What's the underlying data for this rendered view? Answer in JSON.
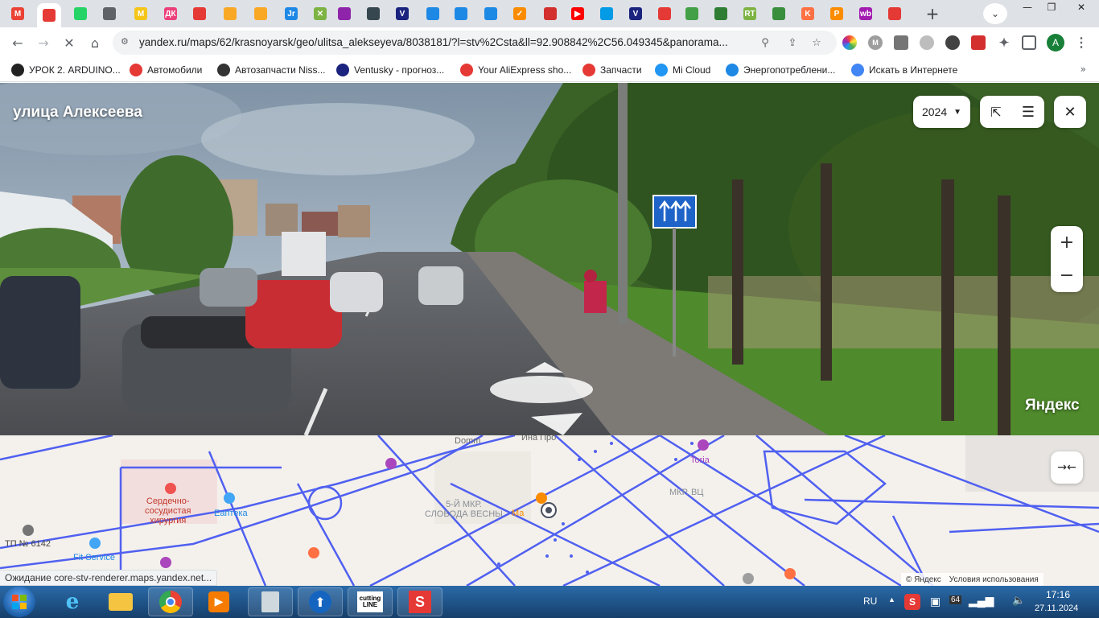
{
  "browser": {
    "tabs": [
      {
        "name": "gmail",
        "label": "M",
        "color": "#ea4335"
      },
      {
        "name": "yandex-maps",
        "label": "",
        "color": "#e53935",
        "active": true
      },
      {
        "name": "whatsapp",
        "label": "",
        "color": "#25d366"
      },
      {
        "name": "chrome-tab",
        "label": "",
        "color": "#5f6368"
      },
      {
        "name": "m-tab",
        "label": "M",
        "color": "#f5c518"
      },
      {
        "name": "dk-tab",
        "label": "ДК",
        "color": "#ec407a"
      },
      {
        "name": "aliexpress-tab",
        "label": "",
        "color": "#e53935"
      },
      {
        "name": "drop-tab-1",
        "label": "",
        "color": "#f9a825"
      },
      {
        "name": "drop-tab-2",
        "label": "",
        "color": "#f9a825"
      },
      {
        "name": "jr-tab",
        "label": "Jr",
        "color": "#1e88e5"
      },
      {
        "name": "x-tab",
        "label": "✕",
        "color": "#7cb342"
      },
      {
        "name": "apps-tab",
        "label": "",
        "color": "#8e24aa"
      },
      {
        "name": "hex-tab",
        "label": "",
        "color": "#37474f"
      },
      {
        "name": "v-tab-1",
        "label": "V",
        "color": "#1a237e"
      },
      {
        "name": "chart-tab-1",
        "label": "",
        "color": "#1e88e5"
      },
      {
        "name": "chart-tab-2",
        "label": "",
        "color": "#1e88e5"
      },
      {
        "name": "chart-tab-3",
        "label": "",
        "color": "#1e88e5"
      },
      {
        "name": "check-tab",
        "label": "✓",
        "color": "#fb8c00"
      },
      {
        "name": "news-tab",
        "label": "",
        "color": "#d32f2f"
      },
      {
        "name": "youtube-tab",
        "label": "▶",
        "color": "#ff0000"
      },
      {
        "name": "cloud-tab",
        "label": "",
        "color": "#039be5"
      },
      {
        "name": "v-tab-2",
        "label": "V",
        "color": "#1a237e"
      },
      {
        "name": "aid-tab",
        "label": "",
        "color": "#e53935"
      },
      {
        "name": "arrow-tab",
        "label": "",
        "color": "#43a047"
      },
      {
        "name": "bank-tab",
        "label": "",
        "color": "#2e7d32"
      },
      {
        "name": "rt-tab",
        "label": "RT",
        "color": "#7cb342"
      },
      {
        "name": "museum-tab",
        "label": "",
        "color": "#388e3c"
      },
      {
        "name": "k-tab",
        "label": "K",
        "color": "#ff7043"
      },
      {
        "name": "p-tab",
        "label": "P",
        "color": "#fb8c00"
      },
      {
        "name": "wb-tab",
        "label": "wb",
        "color": "#a21caf"
      },
      {
        "name": "ozon-tab",
        "label": "",
        "color": "#e53935"
      }
    ],
    "url": "yandex.ru/maps/62/krasnoyarsk/geo/ulitsa_alekseyeva/8038181/?l=stv%2Csta&ll=92.908842%2C56.049345&panorama...",
    "profile_initial": "A",
    "bookmarks": [
      {
        "label": "УРОК 2. ARDUINO...",
        "color": "#222",
        "icon": "ard"
      },
      {
        "label": "Автомобили",
        "color": "#e53935",
        "icon": "drom"
      },
      {
        "label": "Автозапчасти Niss...",
        "color": "#333",
        "icon": "nis"
      },
      {
        "label": "Ventusky - прогноз...",
        "color": "#1a237e",
        "icon": "V"
      },
      {
        "label": "Your AliExpress sho...",
        "color": "#e53935",
        "icon": "ali"
      },
      {
        "label": "Запчасти",
        "color": "#e53935",
        "icon": "drom"
      },
      {
        "label": "Mi Cloud",
        "color": "#2196f3",
        "icon": "mi"
      },
      {
        "label": "Энергопотреблени...",
        "color": "#1e88e5",
        "icon": "en"
      },
      {
        "label": "Искать в Интернете",
        "color": "#4285f4",
        "icon": "G"
      }
    ],
    "status_text": "Ожидание core-stv-renderer.maps.yandex.net..."
  },
  "panorama": {
    "street_name": "улица Алексеева",
    "year": "2024",
    "watermark": "Яндекс"
  },
  "map": {
    "labels": {
      "hospital": "Сердечно-\nсосудистая\nхирургия",
      "apteka": "Еаптека",
      "tp": "ТП № 6142",
      "fit": "Fit Service",
      "district": "5-Й МКР.\nСЛОБОДА ВЕСНЫ",
      "mkr": "МКР. ВЦ",
      "ma": "Ма",
      "copyright": "© Яндекс",
      "terms": "Условия использования",
      "ystop": "Domm",
      "ina": "Ина Про",
      "ria": "Toria"
    }
  },
  "taskbar": {
    "lang": "RU",
    "time": "17:16",
    "date": "27.11.2024",
    "tray_badge": "64"
  }
}
